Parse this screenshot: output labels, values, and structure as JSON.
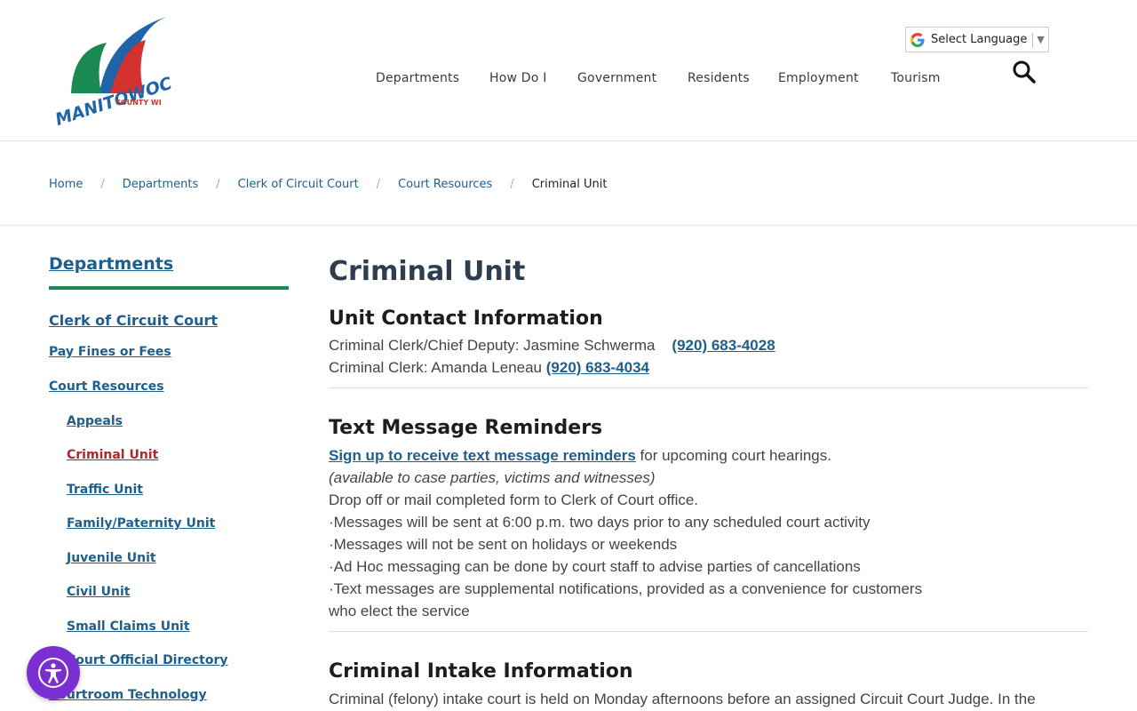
{
  "logo": {
    "text": "MANITOWOC",
    "subtext": "COUNTY WI",
    "colors": {
      "blue": "#1f63a8",
      "green": "#1a8a52",
      "red": "#d5312f"
    }
  },
  "language": {
    "label": "Select Language",
    "arrow": "▼"
  },
  "nav": {
    "items": [
      "Departments",
      "How Do I",
      "Government",
      "Residents",
      "Employment",
      "Tourism"
    ]
  },
  "breadcrumb": {
    "items": [
      "Home",
      "Departments",
      "Clerk of Circuit Court",
      "Court Resources"
    ],
    "current": "Criminal Unit",
    "separator": "/"
  },
  "sidebar": {
    "title": "Departments",
    "section": "Clerk of Circuit Court",
    "items": [
      "Pay Fines or Fees",
      "Court Resources"
    ],
    "subitems": [
      "Appeals",
      "Criminal Unit",
      "Traffic Unit",
      "Family/Paternity Unit",
      "Juvenile Unit",
      "Civil Unit",
      "Small Claims Unit",
      "Court Official Directory",
      "Courtroom Technology"
    ],
    "active": "Criminal Unit"
  },
  "main": {
    "title": "Criminal Unit",
    "contact": {
      "heading": "Unit Contact Information",
      "line1_label": "Criminal Clerk/Chief Deputy:  Jasmine Schwerma",
      "line1_phone": "(920) 683-4028",
      "line2_label": "Criminal Clerk:  Amanda Leneau",
      "line2_phone": "(920) 683-4034"
    },
    "text": {
      "heading": "Text Message Reminders",
      "signup_link": "Sign up to receive text message reminders",
      "signup_rest": " for upcoming court hearings.",
      "available": "(available to case parties, victims and witnesses)",
      "dropoff": "Drop off or mail completed form to Clerk of Court office.",
      "bullets": [
        "·Messages will be sent at 6:00 p.m. two days prior to any scheduled court activity",
        "·Messages will not be sent on holidays or weekends",
        "·Ad Hoc messaging can be done by court staff to advise parties of cancellations",
        "·Text messages are supplemental notifications, provided as a convenience for customers"
      ],
      "bullet_cont": "who elect the service"
    },
    "intake": {
      "heading": "Criminal Intake Information",
      "para": "Criminal (felony) intake court is held on Monday afternoons before an assigned Circuit Court Judge.  In the"
    }
  },
  "accessibility": {
    "icon": "accessibility-icon",
    "color": "#7b2fd0"
  }
}
